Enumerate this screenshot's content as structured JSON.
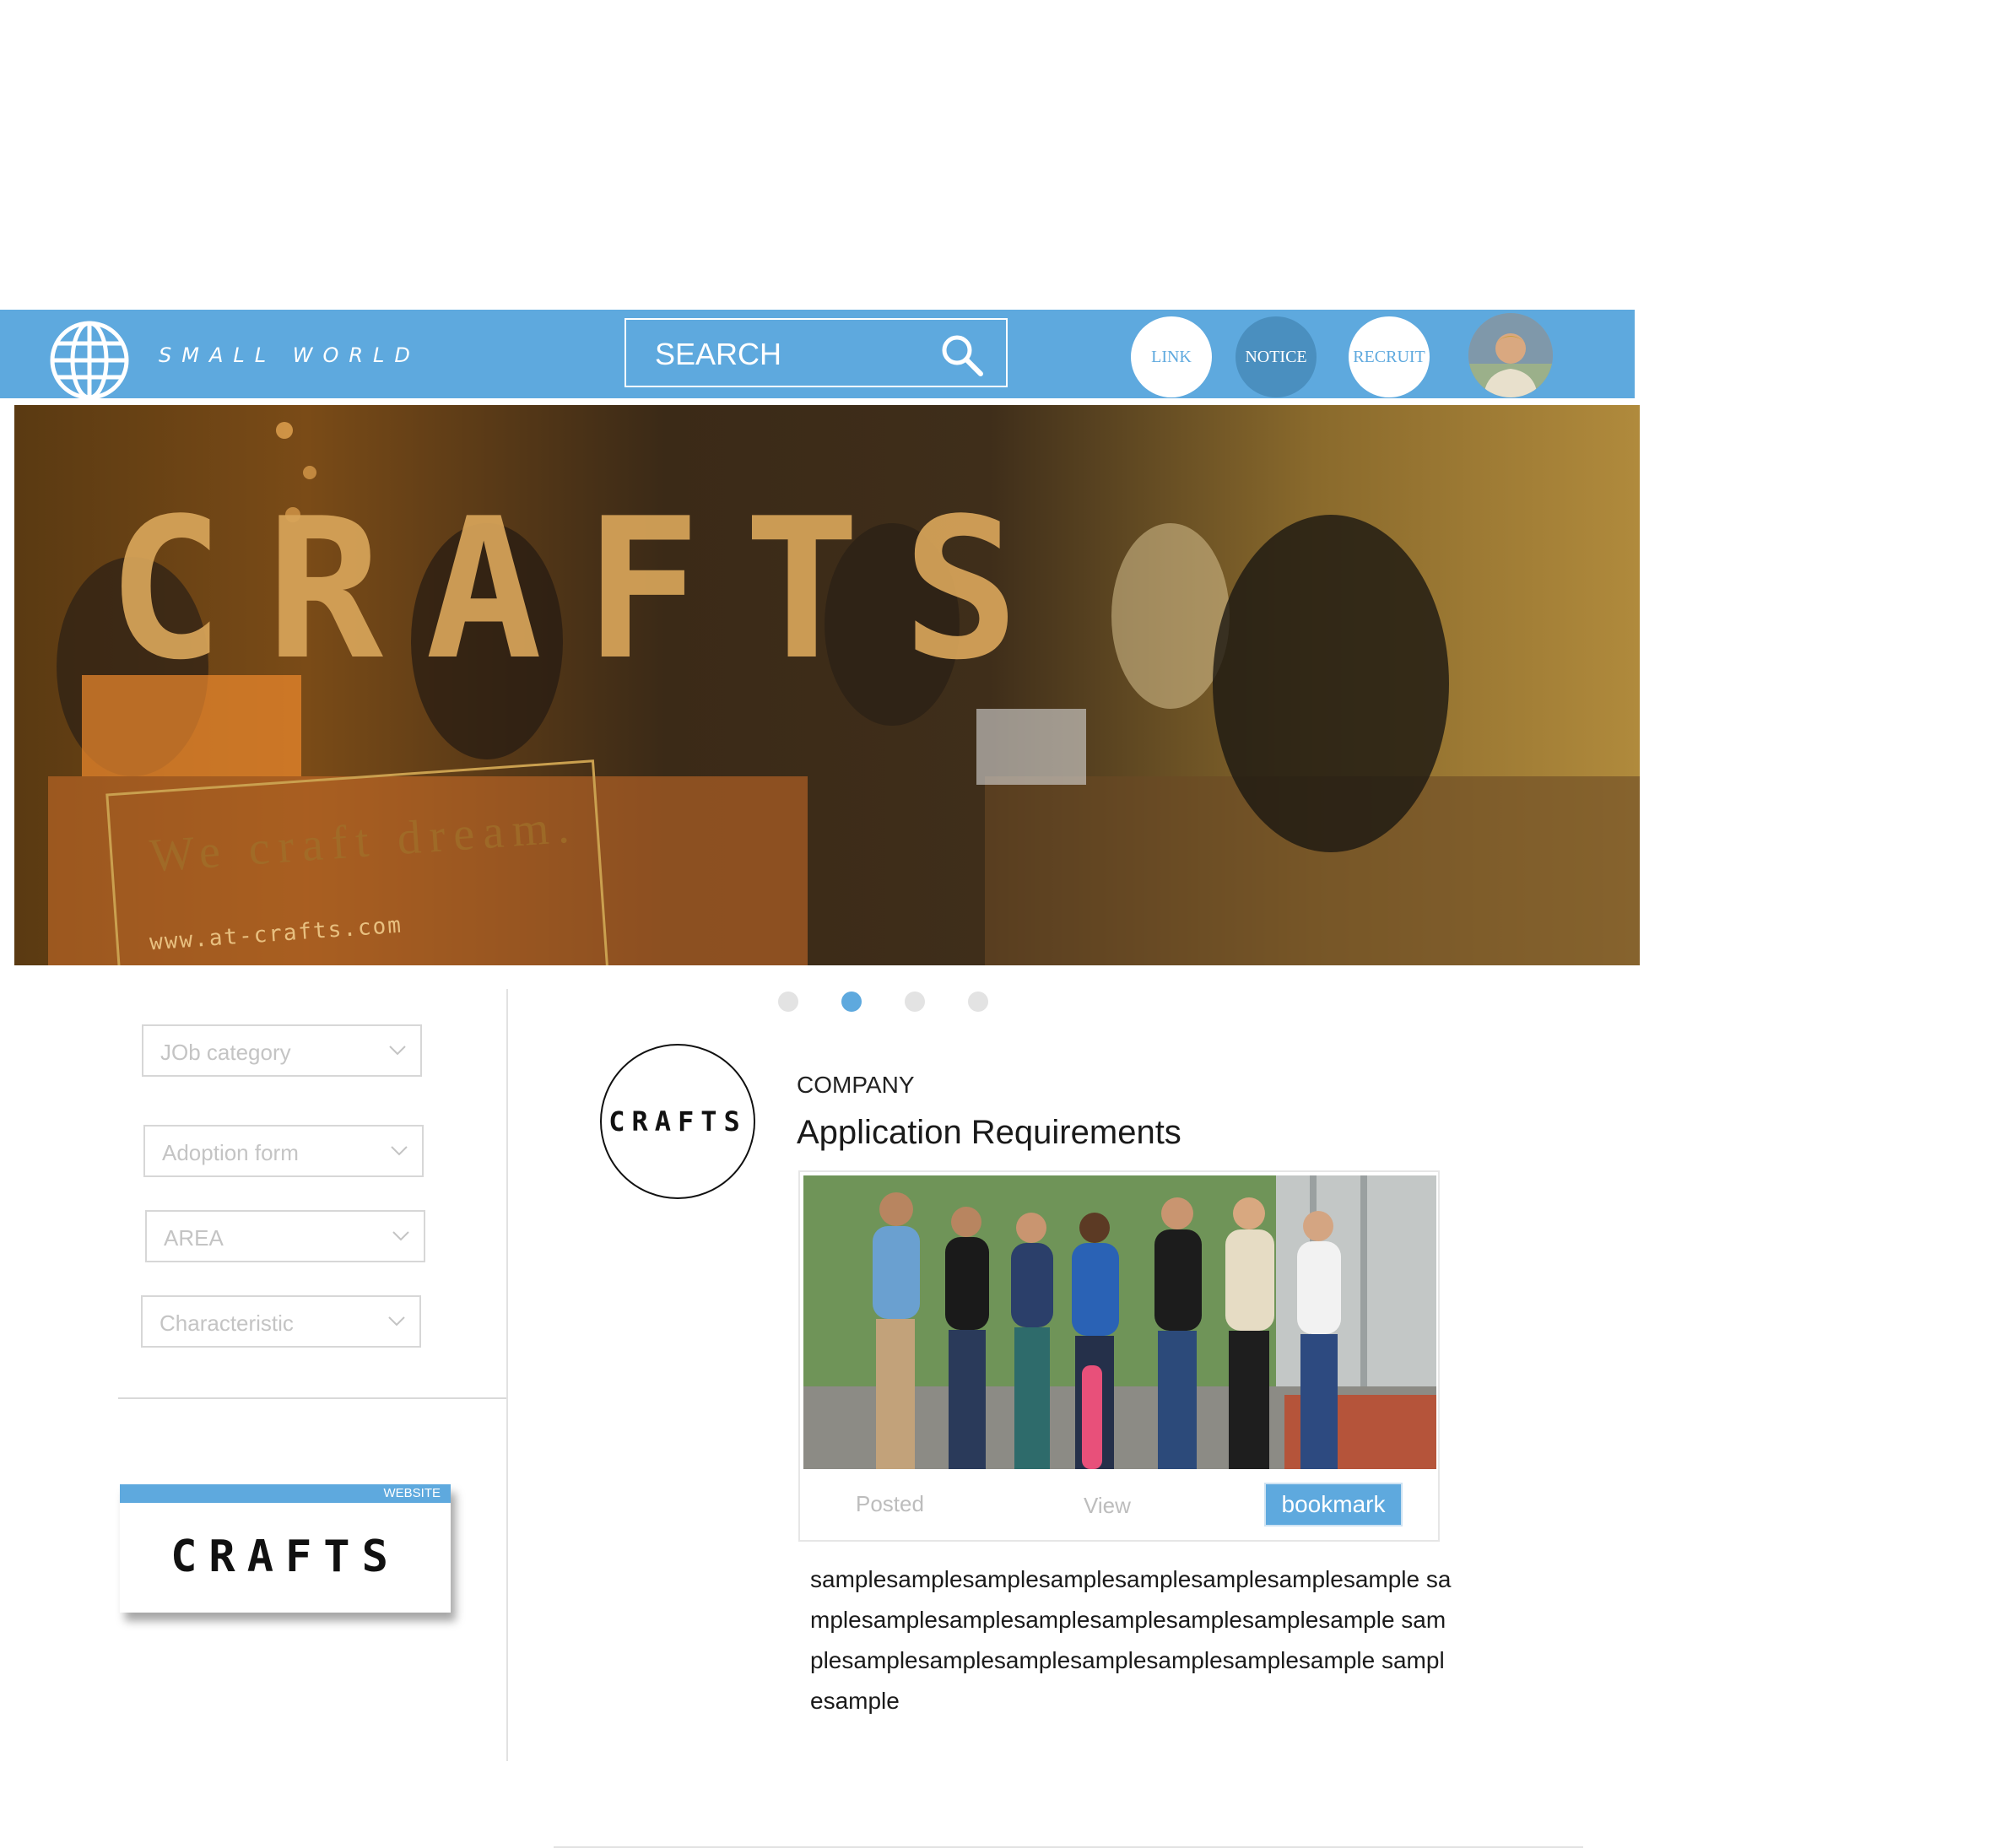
{
  "header": {
    "brand": "SMALL WORLD",
    "search_label": "SEARCH",
    "nav": [
      "LINK",
      "NOTICE",
      "RECRUIT"
    ],
    "color": "#5ea9de"
  },
  "hero": {
    "title": "CRAFTS",
    "tagline": "We craft dream.",
    "url": "www.at-crafts.com"
  },
  "carousel": {
    "count": 4,
    "active_index": 1
  },
  "filters": [
    "JOb category",
    "Adoption form",
    "AREA",
    "Characteristic"
  ],
  "website_card": {
    "tag": "WEBSITE",
    "logo": "CRAFTS"
  },
  "company": {
    "logo": "CRAFTS",
    "label": "COMPANY",
    "title": "Application Requirements"
  },
  "card": {
    "posted": "Posted",
    "view": "View",
    "bookmark": "bookmark"
  },
  "body_text": "samplesamplesamplesamplesamplesamplesamplesample samplesamplesamplesamplesamplesamplesamplesample samplesamplesamplesamplesamplesamplesamplesample samplesample"
}
